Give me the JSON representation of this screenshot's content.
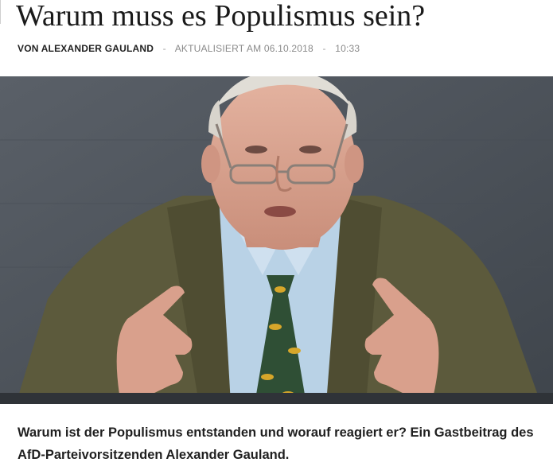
{
  "article": {
    "title": "Warum muss es Populismus sein?",
    "byline": "VON ALEXANDER GAULAND",
    "updated": "AKTUALISIERT AM 06.10.2018",
    "time": "10:33",
    "separator": "-",
    "teaser": "Warum ist der Populismus entstanden und worauf reagiert er? Ein Gastbeitrag des AfD-Parteivorsitzenden Alexander Gauland."
  },
  "photo": {
    "subject": "speaker-portrait",
    "colors": {
      "background": "#4d535b",
      "jacket": "#5c5a3c",
      "shirt": "#b9d2e6",
      "tie": "#2f4f35",
      "tie_pattern": "#d6a62a",
      "skin": "#d9a08c",
      "hair": "#e0ddd6"
    }
  }
}
